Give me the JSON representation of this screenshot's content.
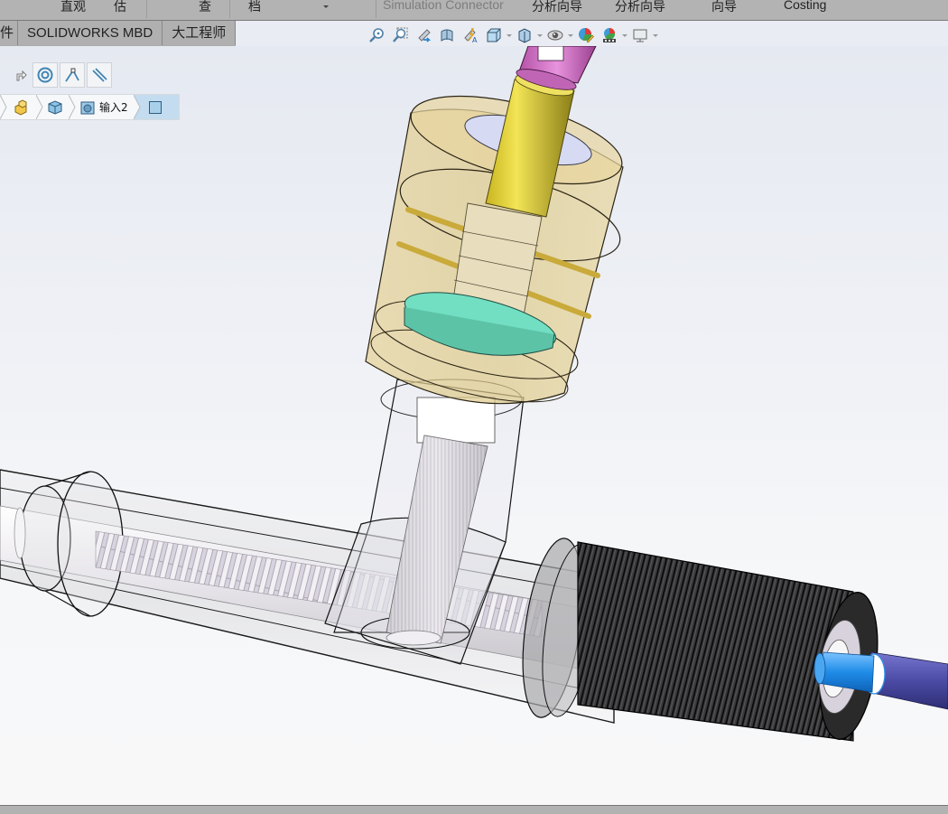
{
  "ribbon": {
    "labels": [
      {
        "text": "直观",
        "disabled": false
      },
      {
        "text": "估",
        "disabled": false
      },
      {
        "text": "查",
        "disabled": false
      },
      {
        "text": "档",
        "disabled": false
      },
      {
        "text": "Simulation Connector",
        "disabled": true
      },
      {
        "text": "分析向导",
        "disabled": false
      },
      {
        "text": "分析向导",
        "disabled": false
      },
      {
        "text": "向导",
        "disabled": false
      },
      {
        "text": "Costing",
        "disabled": false
      }
    ]
  },
  "tabs": [
    {
      "label": "件"
    },
    {
      "label": "SOLIDWORKS MBD"
    },
    {
      "label": "大工程师"
    }
  ],
  "heads_up_toolbar": {
    "icons": [
      "zoom-to-fit-icon",
      "zoom-to-area-icon",
      "previous-view-icon",
      "section-view-icon",
      "dynamic-annotation-view-icon",
      "view-orientation-icon",
      "display-style-icon",
      "hide-show-items-icon",
      "edit-appearance-icon",
      "apply-scene-icon",
      "view-settings-icon"
    ]
  },
  "selection_filter": {
    "icons": [
      "filter-arrow-icon",
      "filter-edges-icon",
      "filter-vertices-icon",
      "filter-faces-icon"
    ]
  },
  "breadcrumb": {
    "items": [
      {
        "icon": "assembly-icon",
        "label": ""
      },
      {
        "icon": "part-icon",
        "label": ""
      },
      {
        "icon": "feature-icon",
        "label": "输入2"
      },
      {
        "icon": "face-icon",
        "label": ""
      }
    ]
  },
  "model": {
    "name": "steering-rack-assembly",
    "colors": {
      "pink_yoke": "#d572c8",
      "yellow_shaft": "#e2d23a",
      "tan_housing": "#e2cd8a",
      "teal_disc": "#6fe0c0",
      "blue_coupler": "#2a8fe8",
      "purple_shaft": "#4f4fa8",
      "dark_spring": "#1a1a1a"
    }
  }
}
